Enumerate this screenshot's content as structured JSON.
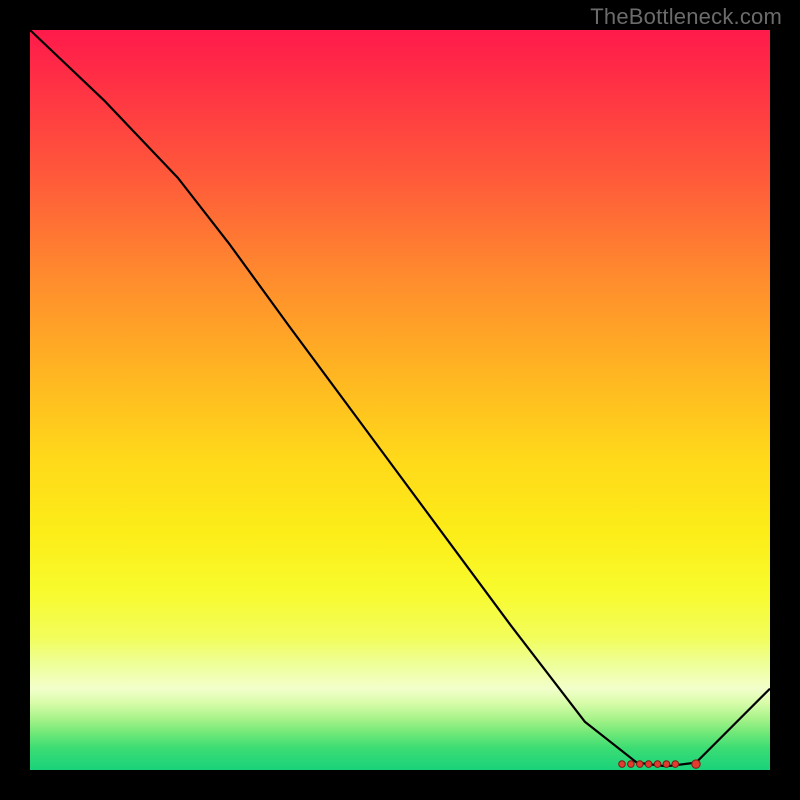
{
  "watermark": "TheBottleneck.com",
  "colors": {
    "line": "#000000",
    "marker_fill": "#e23b2f",
    "marker_stroke": "#7a1d16",
    "gradient_top": "#ff1a4b",
    "gradient_bottom": "#18d27a"
  },
  "chart_data": {
    "type": "line",
    "title": "",
    "xlabel": "",
    "ylabel": "",
    "x": [
      0.0,
      0.1,
      0.2,
      0.27,
      0.35,
      0.45,
      0.55,
      0.65,
      0.75,
      0.82,
      0.86,
      0.9,
      1.0
    ],
    "y": [
      1.0,
      0.905,
      0.8,
      0.71,
      0.6,
      0.465,
      0.33,
      0.195,
      0.065,
      0.01,
      0.005,
      0.01,
      0.11
    ],
    "xlim": [
      0,
      1
    ],
    "ylim": [
      0,
      1
    ],
    "flat_region": {
      "x_start": 0.8,
      "x_end": 0.9,
      "y": 0.008
    },
    "markers": {
      "x": [
        0.8,
        0.812,
        0.824,
        0.836,
        0.848,
        0.86,
        0.872,
        0.9
      ],
      "y": 0.008
    }
  }
}
